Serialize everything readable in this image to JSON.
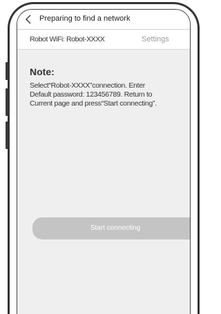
{
  "header": {
    "back_icon": "chevron-left-icon",
    "title": "Preparing to find a network"
  },
  "wifi": {
    "label": "Robot WiFi: Robot-XXXX",
    "settings_label": "Settings"
  },
  "note": {
    "heading": "Note:",
    "lines": [
      "Select“Robot-XXXX”connection. Enter",
      "Default password: 123456789. Return to",
      "Current page and press“Start connecting”."
    ]
  },
  "actions": {
    "start_label": "Start connecting",
    "start_button_color": "#c4c4c4"
  },
  "colors": {
    "screen_background": "#efefef",
    "phone_frame": "#333333"
  }
}
